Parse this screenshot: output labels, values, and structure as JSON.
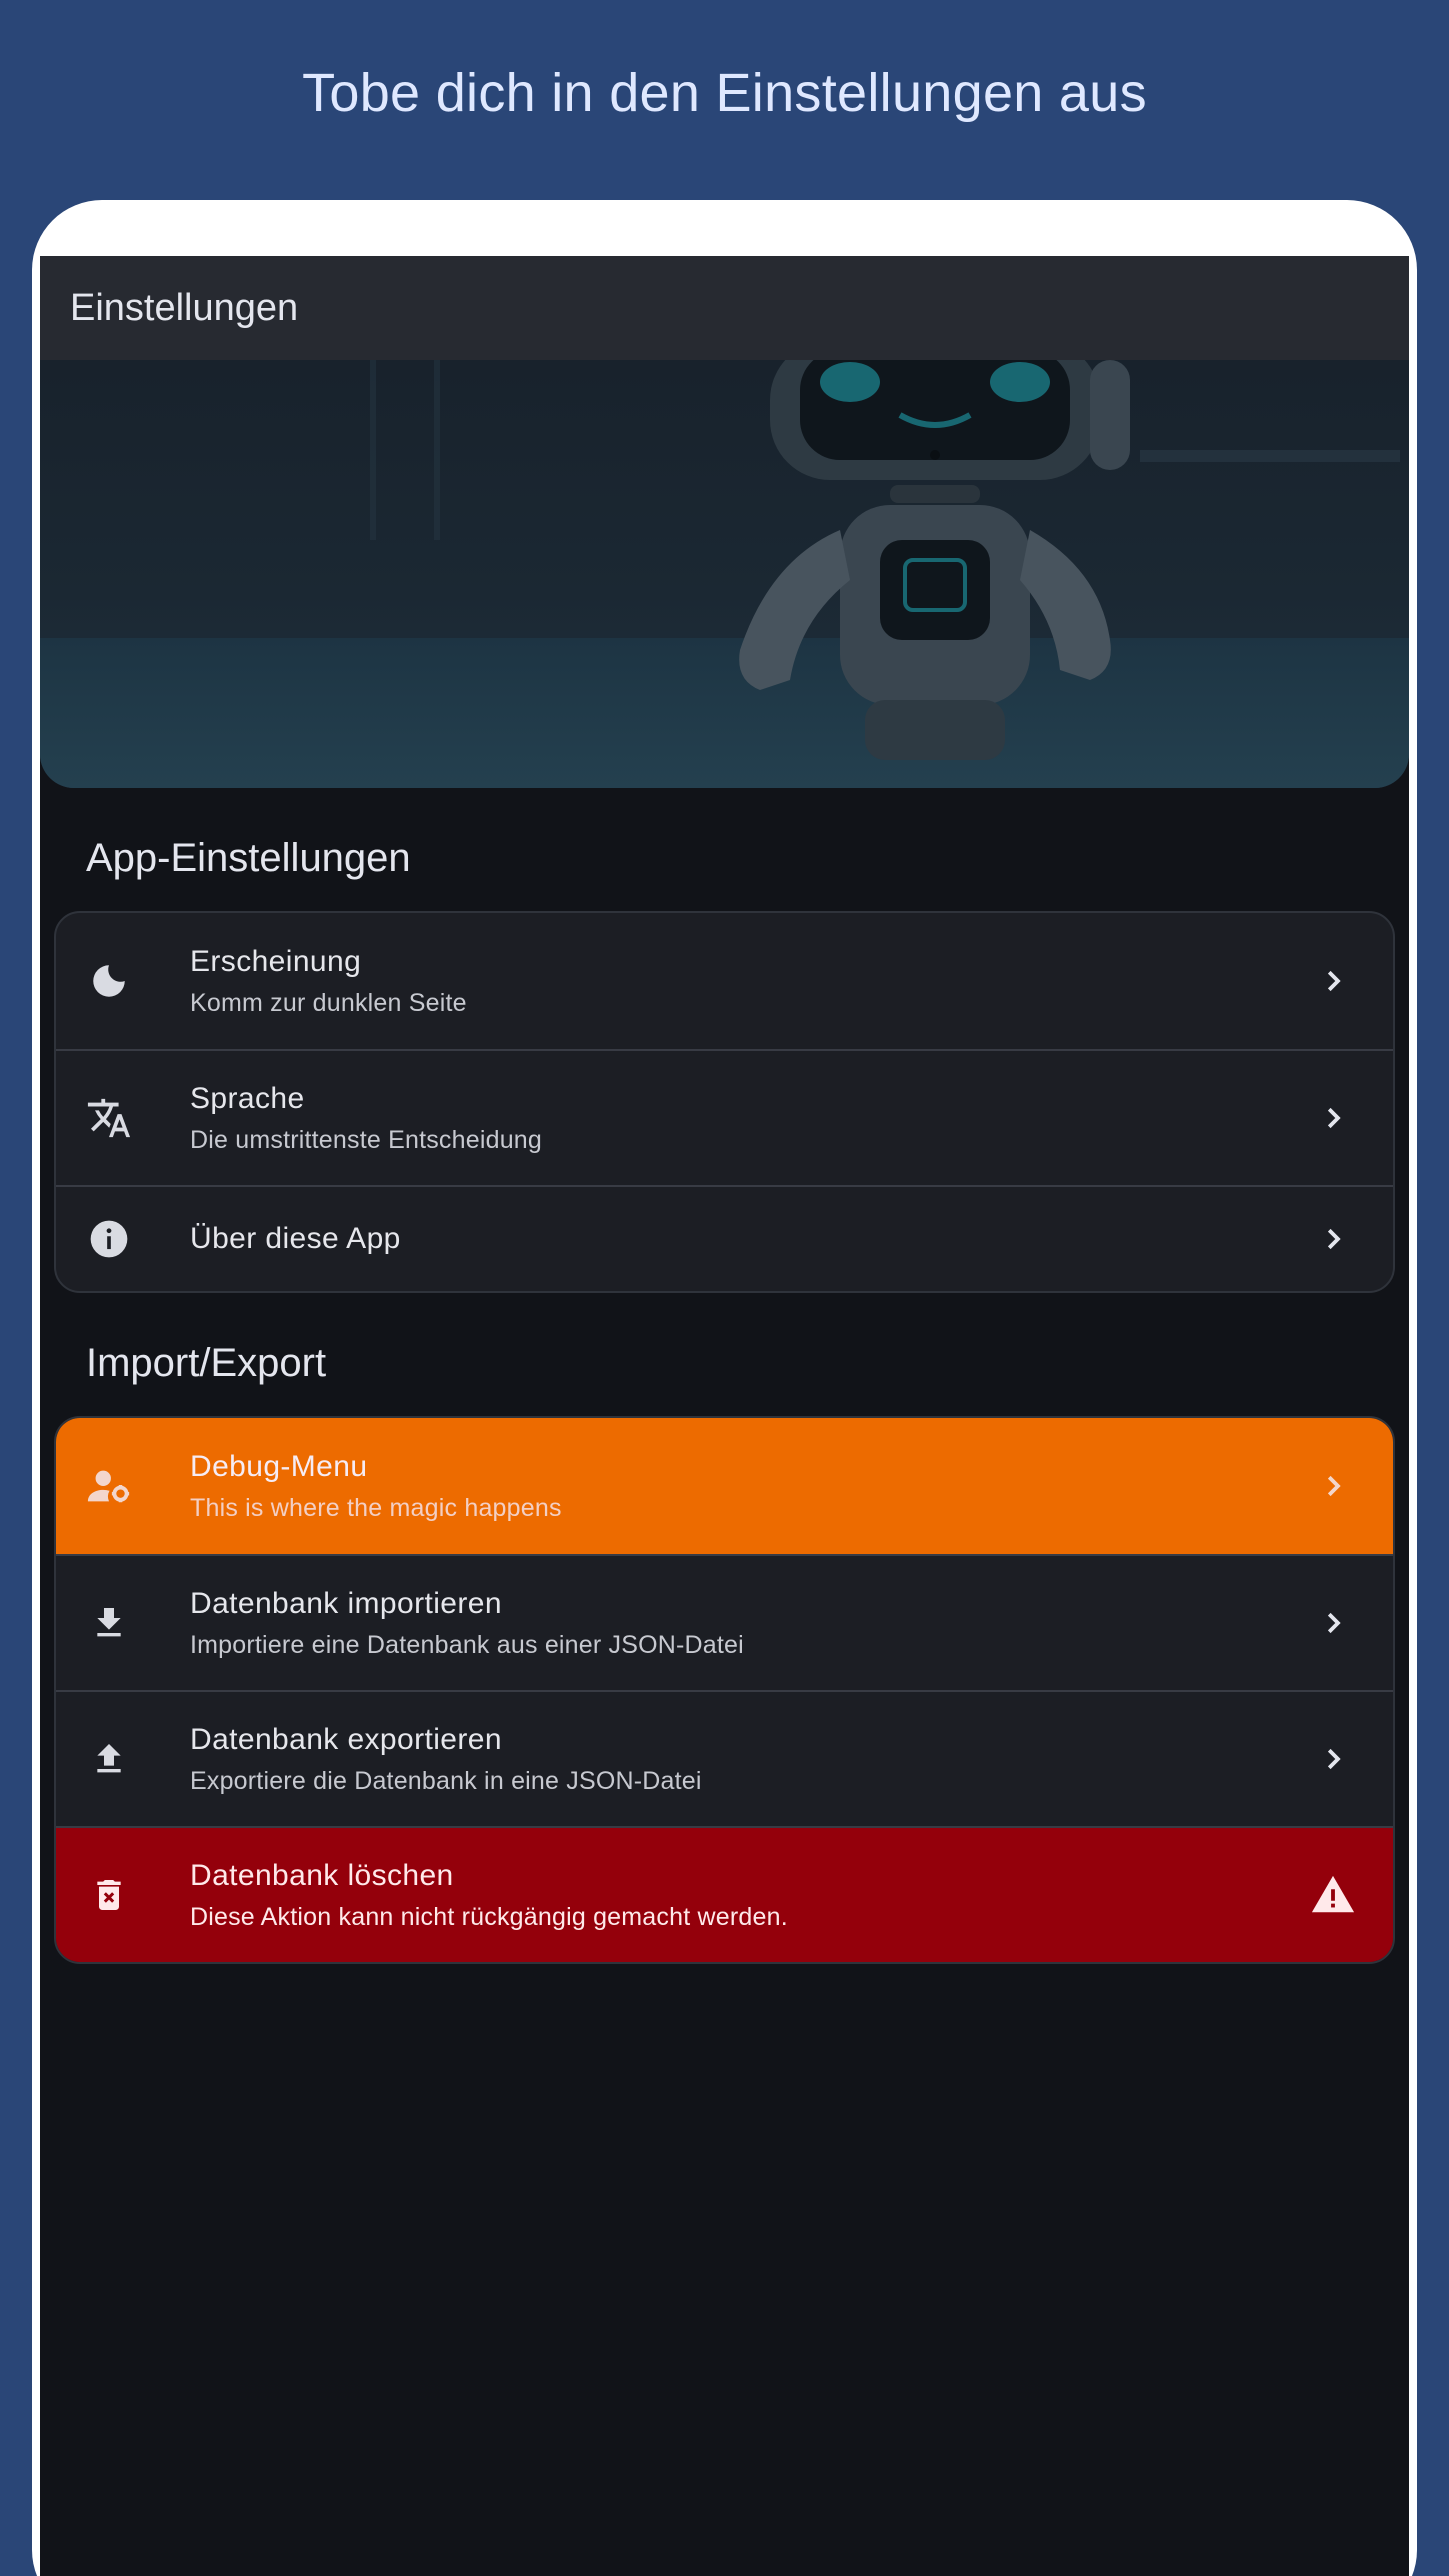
{
  "promo": {
    "title": "Tobe dich in den Einstellungen aus"
  },
  "appbar": {
    "title": "Einstellungen"
  },
  "sections": {
    "app": {
      "title": "App-Einstellungen",
      "items": [
        {
          "label": "Erscheinung",
          "subtitle": "Komm zur dunklen Seite",
          "icon": "moon-icon"
        },
        {
          "label": "Sprache",
          "subtitle": "Die umstrittenste Entscheidung",
          "icon": "translate-icon"
        },
        {
          "label": "Über diese App",
          "icon": "info-icon"
        }
      ]
    },
    "import_export": {
      "title": "Import/Export",
      "items": [
        {
          "label": "Debug-Menu",
          "subtitle": "This is where the magic happens",
          "icon": "admin-gear-icon",
          "color": "#ED6B00"
        },
        {
          "label": "Datenbank importieren",
          "subtitle": "Importiere eine Datenbank aus einer JSON-Datei",
          "icon": "download-icon"
        },
        {
          "label": "Datenbank exportieren",
          "subtitle": "Exportiere die Datenbank in eine JSON-Datei",
          "icon": "upload-icon"
        },
        {
          "label": "Datenbank löschen",
          "subtitle": "Diese Aktion kann nicht rückgängig gemacht werden.",
          "icon": "delete-icon",
          "trailing_icon": "warning-icon",
          "color": "#94000B"
        }
      ]
    }
  },
  "colors": {
    "background": "#2A4677",
    "surface": "#111318",
    "card": "#1C1E24",
    "accent_orange": "#ED6B00",
    "danger_red": "#94000B"
  }
}
